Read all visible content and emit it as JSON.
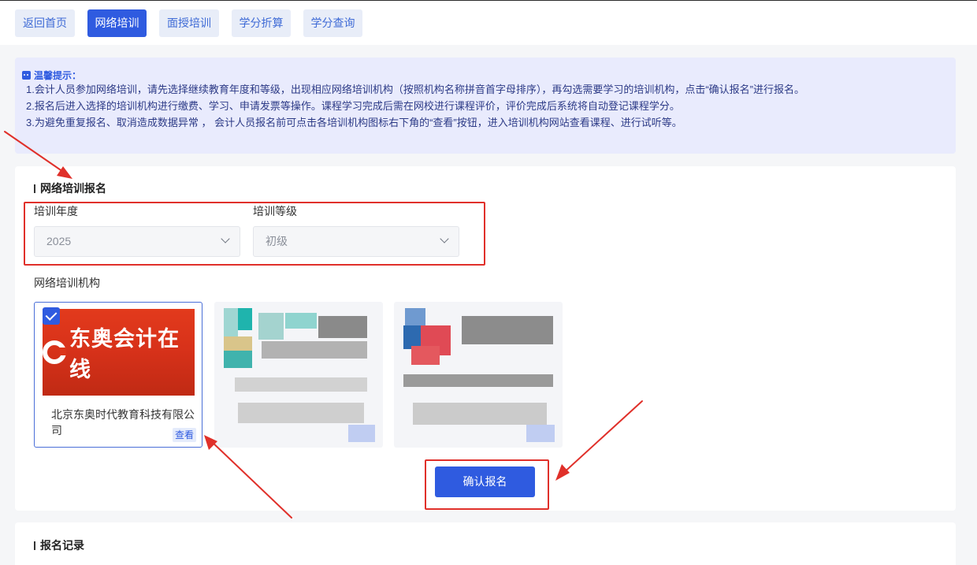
{
  "tabs": [
    {
      "label": "返回首页"
    },
    {
      "label": "网络培训",
      "active": true
    },
    {
      "label": "面授培训"
    },
    {
      "label": "学分折算"
    },
    {
      "label": "学分查询"
    }
  ],
  "notice": {
    "title": "温馨提示：",
    "lines": [
      "1.会计人员参加网络培训，请先选择继续教育年度和等级，出现相应网络培训机构（按照机构名称拼音首字母排序），再勾选需要学习的培训机构，点击“确认报名”进行报名。",
      "2.报名后进入选择的培训机构进行缴费、学习、申请发票等操作。课程学习完成后需在网校进行课程评价，评价完成后系统将自动登记课程学分。",
      "3.为避免重复报名、取消造成数据异常 ， 会计人员报名前可点击各培训机构图标右下角的“查看”按钮，进入培训机构网站查看课程、进行试听等。"
    ]
  },
  "registration": {
    "section_title": "网络培训报名",
    "year_label": "培训年度",
    "year_value": "2025",
    "level_label": "培训等级",
    "level_value": "初级",
    "org_label": "网络培训机构",
    "orgs": [
      {
        "logo_text": "东奥会计在线",
        "name": "北京东奥时代教育科技有限公司",
        "view_label": "查看",
        "checked": true
      }
    ],
    "confirm_label": "确认报名"
  },
  "records": {
    "section_title": "报名记录"
  },
  "colors": {
    "primary": "#2f5be0",
    "notice_bg": "#e9ebfd",
    "annotation_red": "#e0302a",
    "logo_red": "#d8321a"
  }
}
